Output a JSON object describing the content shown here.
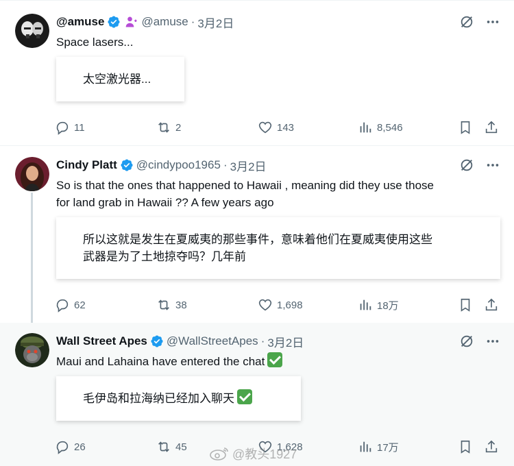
{
  "tweets": [
    {
      "name": "@amuse",
      "handle": "@amuse",
      "date": "3月2日",
      "text": "Space lasers...",
      "translation_lines": [
        "太空激光器..."
      ],
      "replies": "11",
      "reposts": "2",
      "likes": "143",
      "views": "8,546"
    },
    {
      "name": "Cindy Platt",
      "handle": "@cindypoo1965",
      "date": "3月2日",
      "text_lines": [
        "So is that the ones that happened to Hawaii , meaning did they use those",
        "for land grab in Hawaii ?? A few years ago"
      ],
      "translation_lines": [
        "所以这就是发生在夏威夷的那些事件，意味着他们在夏威夷使用这些",
        "武器是为了土地掠夺吗？几年前"
      ],
      "replies": "62",
      "reposts": "38",
      "likes": "1,698",
      "views": "18万"
    },
    {
      "name": "Wall Street Apes",
      "handle": "@WallStreetApes",
      "date": "3月2日",
      "text": "Maui and Lahaina have entered the chat",
      "translation_lines": [
        "毛伊岛和拉海纳已经加入聊天"
      ],
      "replies": "26",
      "reposts": "45",
      "likes": "1,628",
      "views": "17万"
    }
  ],
  "separator": "·",
  "watermark": "@教头1927",
  "colors": {
    "verified": "#1d9bf0",
    "text": "#0f1419",
    "muted": "#536471",
    "check": "#4ba54b"
  }
}
